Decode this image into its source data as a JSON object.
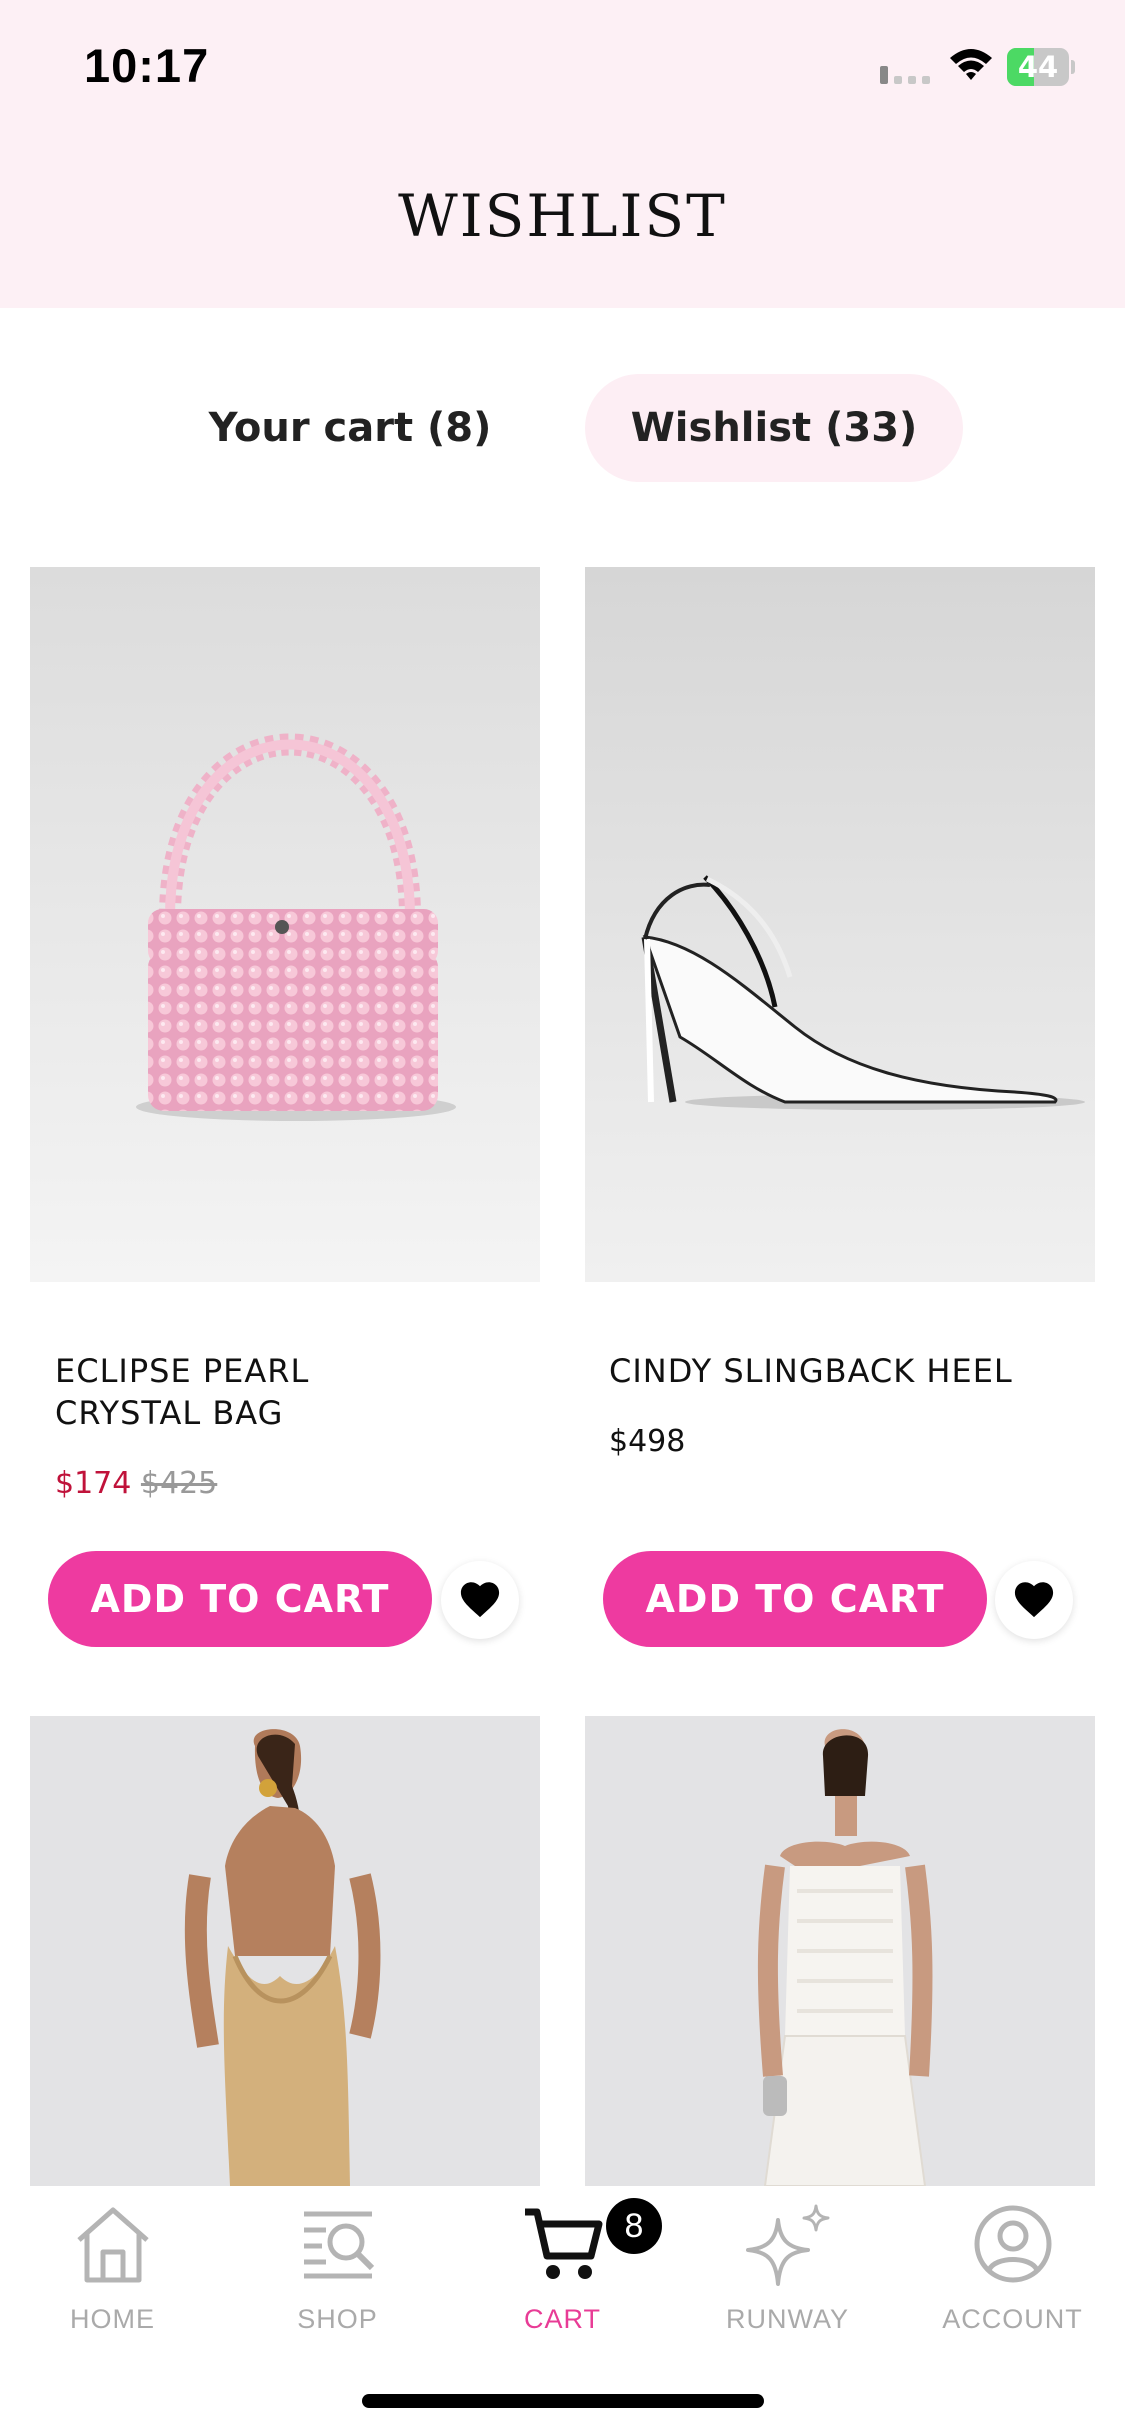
{
  "status_bar": {
    "time": "10:17",
    "battery_level": 44,
    "battery_label": "44"
  },
  "header": {
    "title": "WISHLIST"
  },
  "tabs": [
    {
      "label": "Your cart (8)",
      "active": false
    },
    {
      "label": "Wishlist (33)",
      "active": true
    }
  ],
  "products": [
    {
      "name_line1": "ECLIPSE PEARL",
      "name_line2": "CRYSTAL BAG",
      "sale_price": "$174",
      "original_price": "$425",
      "button_label": "ADD TO CART"
    },
    {
      "name_line1": "CINDY SLINGBACK HEEL",
      "price": "$498",
      "button_label": "ADD TO CART"
    }
  ],
  "nav": {
    "items": [
      {
        "label": "HOME",
        "icon": "home-icon"
      },
      {
        "label": "SHOP",
        "icon": "shop-search-icon"
      },
      {
        "label": "CART",
        "icon": "cart-icon",
        "active": true
      },
      {
        "label": "RUNWAY",
        "icon": "sparkle-icon"
      },
      {
        "label": "ACCOUNT",
        "icon": "account-icon"
      }
    ],
    "cart_badge": "8"
  },
  "colors": {
    "accent_pink": "#ee3aa0",
    "header_bg": "#fdf0f5",
    "sale_red": "#c0123a",
    "active_nav": "#e83c96"
  }
}
